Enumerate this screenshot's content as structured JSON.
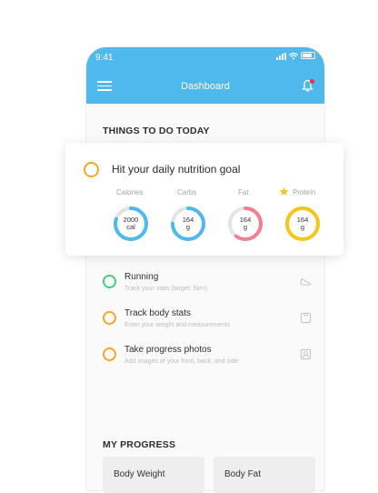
{
  "status_bar": {
    "time": "9:41"
  },
  "header": {
    "title": "Dashboard"
  },
  "things_to_do": {
    "heading": "THINGS TO DO TODAY",
    "nutrition_goal": {
      "title": "Hit your daily nutrition goal",
      "nutrients": [
        {
          "label": "Calories",
          "value": "2000",
          "unit": "cal",
          "color": "#4fb8ec",
          "progress": 0.8
        },
        {
          "label": "Carbs",
          "value": "164",
          "unit": "g",
          "color": "#4fb8ec",
          "progress": 0.75
        },
        {
          "label": "Fat",
          "value": "164",
          "unit": "g",
          "color": "#f47f8f",
          "progress": 0.6
        },
        {
          "label": "Protein",
          "value": "164",
          "unit": "g",
          "color": "#f5c518",
          "progress": 1.0,
          "starred": true
        }
      ]
    },
    "tasks": [
      {
        "title": "Running",
        "subtitle": "Track your stats (target: 5km)",
        "circle_color": "#3ecf7a",
        "icon": "shoe-icon"
      },
      {
        "title": "Track body stats",
        "subtitle": "Enter your weight and measurements",
        "circle_color": "#f6a623",
        "icon": "scale-icon"
      },
      {
        "title": "Take progress photos",
        "subtitle": "Add images of your front, back, and side",
        "circle_color": "#f6a623",
        "icon": "photo-icon"
      }
    ]
  },
  "my_progress": {
    "heading": "MY PROGRESS",
    "cards": [
      {
        "label": "Body Weight"
      },
      {
        "label": "Body Fat"
      }
    ]
  },
  "colors": {
    "accent": "#4fb8ec",
    "goal_circle": "#f6a623",
    "notification_dot": "#e8344e"
  }
}
